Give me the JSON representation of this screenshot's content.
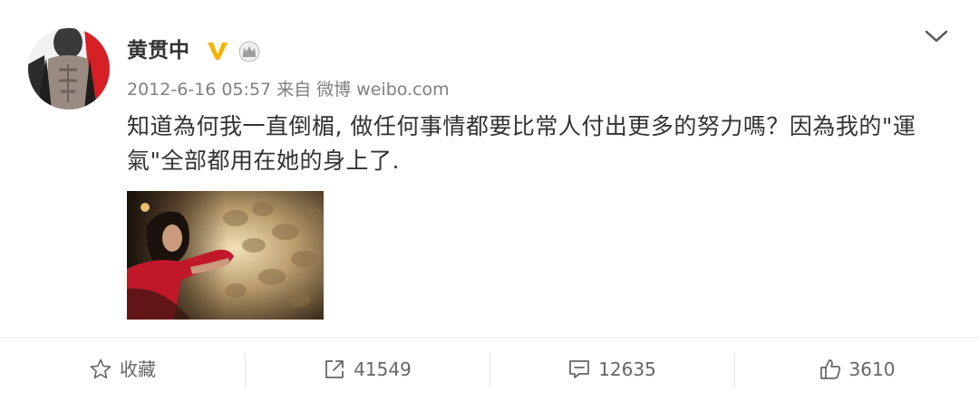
{
  "post": {
    "username": "黄贯中",
    "timestamp": "2012-6-16 05:57",
    "source_prefix": "来自",
    "source": "微博 weibo.com",
    "text": "知道為何我一直倒楣, 做任何事情都要比常人付出更多的努力嗎？因為我的\"運氣\"全部都用在她的身上了.",
    "verified_badge_color": "#f5b400"
  },
  "actions": {
    "favorite_label": "收藏",
    "repost_count": "41549",
    "comment_count": "12635",
    "like_count": "3610"
  },
  "icons": {
    "expand": "chevron-down-icon",
    "verified": "verified-v-icon",
    "member": "crown-icon",
    "favorite": "star-icon",
    "repost": "share-icon",
    "comment": "comment-icon",
    "like": "thumbs-up-icon"
  }
}
